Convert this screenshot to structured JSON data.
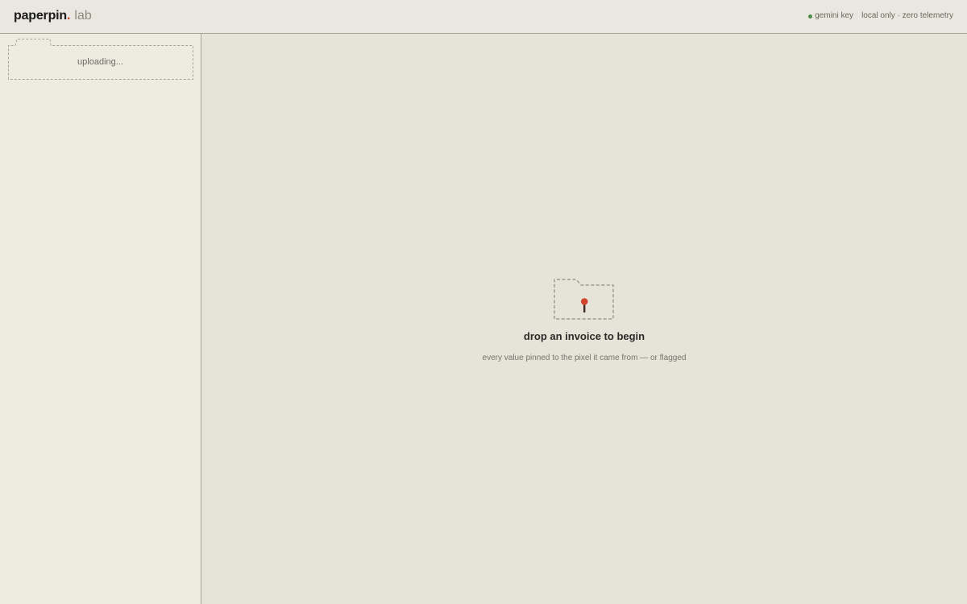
{
  "header": {
    "brand": "paperpin",
    "brand_dot": ".",
    "brand_suffix": "lab",
    "api_key_status": "gemini key",
    "privacy_note": "local only · zero telemetry"
  },
  "sidebar": {
    "upload_status": "uploading..."
  },
  "empty_state": {
    "icon": "folder-with-pin-icon",
    "title": "drop an invoice to begin",
    "subtitle": "every value pinned to the pixel it came from — or flagged"
  },
  "colors": {
    "background": "#e6e3d8",
    "sidebar_background": "#eeebe0",
    "accent_red": "#d2452c",
    "status_green": "#4f8a4a",
    "border": "#a8a596"
  }
}
